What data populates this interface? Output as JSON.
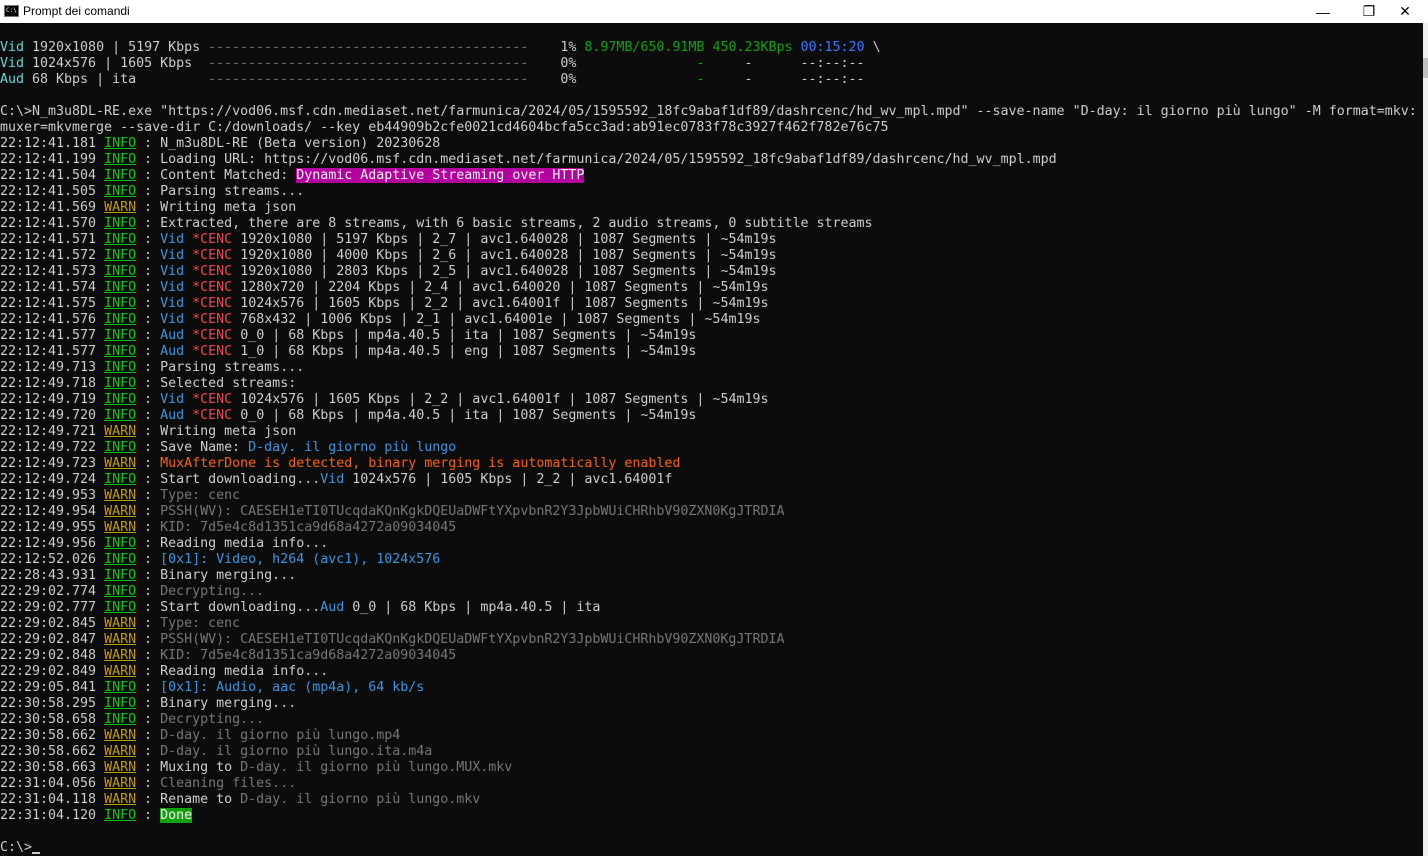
{
  "window": {
    "title": "Prompt dei comandi",
    "icon": "cmd-icon",
    "minimize_glyph": "—",
    "maximize_glyph": "❐",
    "close_glyph": "✕"
  },
  "progress": [
    {
      "type": "Vid",
      "desc": "1920x1080 | 5197 Kbps",
      "bar": "----------------------------------------",
      "percent": "1%",
      "size": "8.97MB/650.91MB",
      "speed": "450.23KBps",
      "eta": "00:15:20",
      "tail": "\\"
    },
    {
      "type": "Vid",
      "desc": "1024x576 | 1605 Kbps",
      "bar": "----------------------------------------",
      "percent": "0%",
      "size": "",
      "speed": "-",
      "speed2": "-",
      "eta": "--:--:--",
      "tail": ""
    },
    {
      "type": "Aud",
      "desc": "68 Kbps | ita",
      "bar": "----------------------------------------",
      "percent": "0%",
      "size": "",
      "speed": "-",
      "speed2": "-",
      "eta": "--:--:--",
      "tail": ""
    }
  ],
  "command": {
    "line1": "C:\\>N_m3u8DL-RE.exe \"https://vod06.msf.cdn.mediaset.net/farmunica/2024/05/1595592_18fc9abaf1df89/dashrcenc/hd_wv_mpl.mpd\" --save-name \"D-day: il giorno più lungo\" -M format=mkv:",
    "line2": "muxer=mkvmerge --save-dir C:/downloads/ --key eb44909b2cfe0021cd4604bcfa5cc3ad:ab91ec0783f78c3927f462f782e76c75"
  },
  "log": [
    {
      "t": "22:12:41.181",
      "lvl": "INFO",
      "parts": [
        [
          "N_m3u8DL-RE (Beta version) 20230628",
          "default"
        ]
      ]
    },
    {
      "t": "22:12:41.199",
      "lvl": "INFO",
      "parts": [
        [
          "Loading URL: https://vod06.msf.cdn.mediaset.net/farmunica/2024/05/1595592_18fc9abaf1df89/dashrcenc/hd_wv_mpl.mpd",
          "default"
        ]
      ]
    },
    {
      "t": "22:12:41.504",
      "lvl": "INFO",
      "parts": [
        [
          "Content Matched: ",
          "default"
        ],
        [
          "Dynamic Adaptive Streaming over HTTP",
          "hl-magenta"
        ]
      ]
    },
    {
      "t": "22:12:41.505",
      "lvl": "INFO",
      "parts": [
        [
          "Parsing streams...",
          "default"
        ]
      ]
    },
    {
      "t": "22:12:41.569",
      "lvl": "WARN",
      "parts": [
        [
          "Writing meta json",
          "default"
        ]
      ]
    },
    {
      "t": "22:12:41.570",
      "lvl": "INFO",
      "parts": [
        [
          "Extracted, there are 8 streams, with 6 basic streams, 2 audio streams, 0 subtitle streams",
          "default"
        ]
      ]
    },
    {
      "t": "22:12:41.571",
      "lvl": "INFO",
      "parts": [
        [
          "Vid ",
          "vid"
        ],
        [
          "*CENC ",
          "cenc"
        ],
        [
          "1920x1080 | 5197 Kbps | 2_7 | avc1.640028 | 1087 Segments | ~54m19s",
          "default"
        ]
      ]
    },
    {
      "t": "22:12:41.572",
      "lvl": "INFO",
      "parts": [
        [
          "Vid ",
          "vid"
        ],
        [
          "*CENC ",
          "cenc"
        ],
        [
          "1920x1080 | 4000 Kbps | 2_6 | avc1.640028 | 1087 Segments | ~54m19s",
          "default"
        ]
      ]
    },
    {
      "t": "22:12:41.573",
      "lvl": "INFO",
      "parts": [
        [
          "Vid ",
          "vid"
        ],
        [
          "*CENC ",
          "cenc"
        ],
        [
          "1920x1080 | 2803 Kbps | 2_5 | avc1.640028 | 1087 Segments | ~54m19s",
          "default"
        ]
      ]
    },
    {
      "t": "22:12:41.574",
      "lvl": "INFO",
      "parts": [
        [
          "Vid ",
          "vid"
        ],
        [
          "*CENC ",
          "cenc"
        ],
        [
          "1280x720 | 2204 Kbps | 2_4 | avc1.640020 | 1087 Segments | ~54m19s",
          "default"
        ]
      ]
    },
    {
      "t": "22:12:41.575",
      "lvl": "INFO",
      "parts": [
        [
          "Vid ",
          "vid"
        ],
        [
          "*CENC ",
          "cenc"
        ],
        [
          "1024x576 | 1605 Kbps | 2_2 | avc1.64001f | 1087 Segments | ~54m19s",
          "default"
        ]
      ]
    },
    {
      "t": "22:12:41.576",
      "lvl": "INFO",
      "parts": [
        [
          "Vid ",
          "vid"
        ],
        [
          "*CENC ",
          "cenc"
        ],
        [
          "768x432 | 1006 Kbps | 2_1 | avc1.64001e | 1087 Segments | ~54m19s",
          "default"
        ]
      ]
    },
    {
      "t": "22:12:41.577",
      "lvl": "INFO",
      "parts": [
        [
          "Aud ",
          "vid"
        ],
        [
          "*CENC ",
          "cenc"
        ],
        [
          "0_0 | 68 Kbps | mp4a.40.5 | ita | 1087 Segments | ~54m19s",
          "default"
        ]
      ]
    },
    {
      "t": "22:12:41.577",
      "lvl": "INFO",
      "parts": [
        [
          "Aud ",
          "vid"
        ],
        [
          "*CENC ",
          "cenc"
        ],
        [
          "1_0 | 68 Kbps | mp4a.40.5 | eng | 1087 Segments | ~54m19s",
          "default"
        ]
      ]
    },
    {
      "t": "22:12:49.713",
      "lvl": "INFO",
      "parts": [
        [
          "Parsing streams...",
          "default"
        ]
      ]
    },
    {
      "t": "22:12:49.718",
      "lvl": "INFO",
      "parts": [
        [
          "Selected streams:",
          "default"
        ]
      ]
    },
    {
      "t": "22:12:49.719",
      "lvl": "INFO",
      "parts": [
        [
          "Vid ",
          "vid"
        ],
        [
          "*CENC ",
          "cenc"
        ],
        [
          "1024x576 | 1605 Kbps | 2_2 | avc1.64001f | 1087 Segments | ~54m19s",
          "default"
        ]
      ]
    },
    {
      "t": "22:12:49.720",
      "lvl": "INFO",
      "parts": [
        [
          "Aud ",
          "vid"
        ],
        [
          "*CENC ",
          "cenc"
        ],
        [
          "0_0 | 68 Kbps | mp4a.40.5 | ita | 1087 Segments | ~54m19s",
          "default"
        ]
      ]
    },
    {
      "t": "22:12:49.721",
      "lvl": "WARN",
      "parts": [
        [
          "Writing meta json",
          "default"
        ]
      ]
    },
    {
      "t": "22:12:49.722",
      "lvl": "INFO",
      "parts": [
        [
          "Save Name: ",
          "default"
        ],
        [
          "D-day. il giorno più lungo",
          "vid"
        ]
      ]
    },
    {
      "t": "22:12:49.723",
      "lvl": "WARN",
      "parts": [
        [
          "MuxAfterDone is detected, binary merging is automatically enabled",
          "orange"
        ]
      ]
    },
    {
      "t": "22:12:49.724",
      "lvl": "INFO",
      "parts": [
        [
          "Start downloading...",
          "default"
        ],
        [
          "Vid ",
          "vid"
        ],
        [
          "1024x576 | 1605 Kbps | 2_2 | avc1.64001f",
          "default"
        ]
      ]
    },
    {
      "t": "22:12:49.953",
      "lvl": "WARN",
      "parts": [
        [
          "Type: cenc",
          "gray"
        ]
      ]
    },
    {
      "t": "22:12:49.954",
      "lvl": "WARN",
      "parts": [
        [
          "PSSH(WV): CAESEH1eTI0TUcqdaKQnKgkDQEUaDWFtYXpvbnR2Y3JpbWUiCHRhbV90ZXN0KgJTRDIA",
          "gray"
        ]
      ]
    },
    {
      "t": "22:12:49.955",
      "lvl": "WARN",
      "parts": [
        [
          "KID: 7d5e4c8d1351ca9d68a4272a09034045",
          "gray"
        ]
      ]
    },
    {
      "t": "22:12:49.956",
      "lvl": "INFO",
      "parts": [
        [
          "Reading media info...",
          "default"
        ]
      ]
    },
    {
      "t": "22:12:52.026",
      "lvl": "INFO",
      "parts": [
        [
          "[0x1]: Video, h264 (avc1), 1024x576",
          "lightblue"
        ]
      ]
    },
    {
      "t": "22:28:43.931",
      "lvl": "INFO",
      "parts": [
        [
          "Binary merging...",
          "default"
        ]
      ]
    },
    {
      "t": "22:29:02.774",
      "lvl": "INFO",
      "parts": [
        [
          "Decrypting...",
          "gray"
        ]
      ]
    },
    {
      "t": "22:29:02.777",
      "lvl": "INFO",
      "parts": [
        [
          "Start downloading...",
          "default"
        ],
        [
          "Aud ",
          "vid"
        ],
        [
          "0_0 | 68 Kbps | mp4a.40.5 | ita",
          "default"
        ]
      ]
    },
    {
      "t": "22:29:02.845",
      "lvl": "WARN",
      "parts": [
        [
          "Type: cenc",
          "gray"
        ]
      ]
    },
    {
      "t": "22:29:02.847",
      "lvl": "WARN",
      "parts": [
        [
          "PSSH(WV): CAESEH1eTI0TUcqdaKQnKgkDQEUaDWFtYXpvbnR2Y3JpbWUiCHRhbV90ZXN0KgJTRDIA",
          "gray"
        ]
      ]
    },
    {
      "t": "22:29:02.848",
      "lvl": "WARN",
      "parts": [
        [
          "KID: 7d5e4c8d1351ca9d68a4272a09034045",
          "gray"
        ]
      ]
    },
    {
      "t": "22:29:02.849",
      "lvl": "WARN",
      "parts": [
        [
          "Reading media info...",
          "default"
        ]
      ]
    },
    {
      "t": "22:29:05.841",
      "lvl": "INFO",
      "parts": [
        [
          "[0x1]: Audio, aac (mp4a), 64 kb/s",
          "lightblue"
        ]
      ]
    },
    {
      "t": "22:30:58.295",
      "lvl": "INFO",
      "parts": [
        [
          "Binary merging...",
          "default"
        ]
      ]
    },
    {
      "t": "22:30:58.658",
      "lvl": "INFO",
      "parts": [
        [
          "Decrypting...",
          "gray"
        ]
      ]
    },
    {
      "t": "22:30:58.662",
      "lvl": "WARN",
      "parts": [
        [
          "D-day. il giorno più lungo.mp4",
          "gray"
        ]
      ]
    },
    {
      "t": "22:30:58.662",
      "lvl": "WARN",
      "parts": [
        [
          "D-day. il giorno più lungo.ita.m4a",
          "gray"
        ]
      ]
    },
    {
      "t": "22:30:58.663",
      "lvl": "WARN",
      "parts": [
        [
          "Muxing to ",
          "default"
        ],
        [
          "D-day. il giorno più lungo.MUX.mkv",
          "gray"
        ]
      ]
    },
    {
      "t": "22:31:04.056",
      "lvl": "WARN",
      "parts": [
        [
          "Cleaning files...",
          "gray"
        ]
      ]
    },
    {
      "t": "22:31:04.118",
      "lvl": "WARN",
      "parts": [
        [
          "Rename to ",
          "default"
        ],
        [
          "D-day. il giorno più lungo.mkv",
          "gray"
        ]
      ]
    },
    {
      "t": "22:31:04.120",
      "lvl": "INFO",
      "parts": [
        [
          "Done",
          "hl-green"
        ]
      ]
    }
  ],
  "prompt": "C:\\>",
  "colors": {
    "background": "#0c0c0c",
    "foreground": "#cccccc",
    "info": "#16c60c",
    "warn": "#c19c00",
    "stream_type": "#3a96dd",
    "cenc": "#e74856",
    "progress_size": "#13a10e",
    "eta": "#3b78ff",
    "highlight_magenta": "#b4009e",
    "highlight_green": "#13a10e"
  }
}
